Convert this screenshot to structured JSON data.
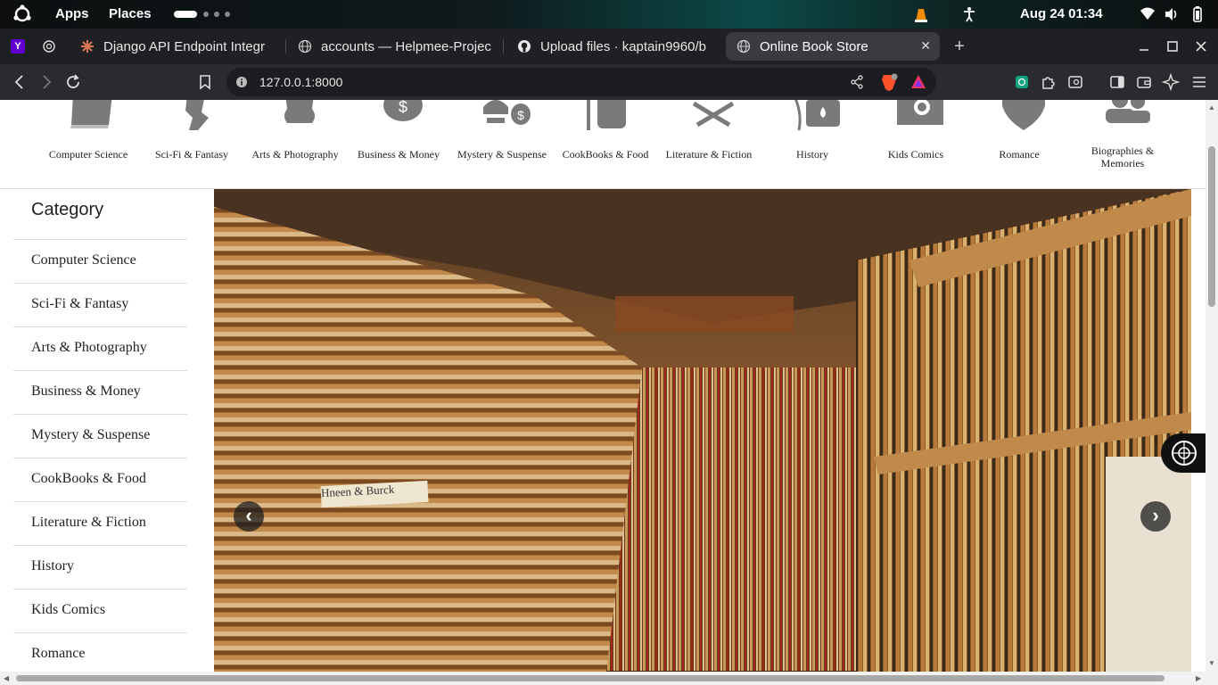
{
  "system_bar": {
    "apps": "Apps",
    "places": "Places",
    "datetime": "Aug 24  01:34"
  },
  "tabs": [
    {
      "title": "Django API Endpoint Integr"
    },
    {
      "title": "accounts — Helpmee-Projec"
    },
    {
      "title": "Upload files · kaptain9960/b"
    },
    {
      "title": "Online Book Store"
    }
  ],
  "address_bar": {
    "url": "127.0.0.1:8000"
  },
  "category_bar": [
    {
      "label": "Computer Science"
    },
    {
      "label": "Sci-Fi & Fantasy"
    },
    {
      "label": "Arts & Photography"
    },
    {
      "label": "Business & Money"
    },
    {
      "label": "Mystery & Suspense"
    },
    {
      "label": "CookBooks & Food"
    },
    {
      "label": "Literature & Fiction"
    },
    {
      "label": "History"
    },
    {
      "label": "Kids Comics"
    },
    {
      "label": "Romance"
    },
    {
      "label": "Biographies & Memories"
    }
  ],
  "sidebar": {
    "heading": "Category",
    "items": [
      {
        "label": "Computer Science"
      },
      {
        "label": "Sci-Fi & Fantasy"
      },
      {
        "label": "Arts & Photography"
      },
      {
        "label": "Business & Money"
      },
      {
        "label": "Mystery & Suspense"
      },
      {
        "label": "CookBooks & Food"
      },
      {
        "label": "Literature & Fiction"
      },
      {
        "label": "History"
      },
      {
        "label": "Kids Comics"
      },
      {
        "label": "Romance"
      }
    ]
  },
  "carousel": {
    "prev_symbol": "‹",
    "next_symbol": "›",
    "spine_text": "Hneen & Burck"
  },
  "colors": {
    "accent_tab_bg": "#3a3b3f",
    "page_text": "#222222",
    "icon_gray": "#7a7a7a"
  }
}
